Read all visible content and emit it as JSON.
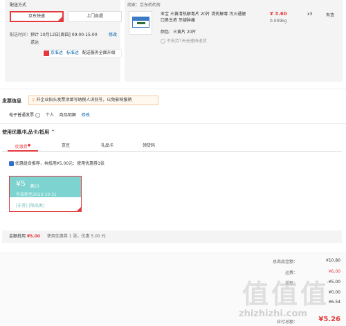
{
  "delivery": {
    "title": "配送方式",
    "options": [
      "京东快递",
      "上门自提"
    ],
    "time_label": "配送时间：",
    "time_value": "预计 10月12日[周四] 09:00-15:00 送达",
    "modify": "修改",
    "badges": [
      "京准达",
      "标准达",
      "配送服务全面升级"
    ]
  },
  "store": {
    "merchant": "商家：京东药药房",
    "product_name": "亚宝 三黄清热解毒片 20片 清热解毒 泻火通便 口鼻生疮 牙龈肿痛",
    "price": "¥ 3.60",
    "weight": "0.009kg",
    "qty": "x3",
    "stock": "有货",
    "color_label": "颜色：",
    "color_value": "三黄片 20片",
    "no_return": "不支持7天无理由退货"
  },
  "invoice": {
    "title": "发票信息",
    "notice": "开企业抬头发票须填写纳税人识别号，以免影响报销",
    "type": "电子普通发票",
    "person": "个人",
    "detail": "商品明细",
    "modify": "修改"
  },
  "coupon_section": {
    "title": "使用优惠/礼品卡/抵用",
    "tabs": [
      "优惠券",
      "京豆",
      "礼品卡",
      "领货码"
    ],
    "recommend": "优惠组合推荐，共抵用¥5.00元：使用优惠券1张",
    "coupon": {
      "amount": "¥5",
      "cond": "满10",
      "expire": "有效期至2023-10-31",
      "tags": "[东券] [限品类]"
    },
    "summary_label": "金额抵用",
    "summary_amount": "¥5.00",
    "summary_detail": "使用优惠券 1 张，优惠 5.00 元"
  },
  "totals": {
    "goods_label": "总商品金额：",
    "goods_value": "¥10.80",
    "freight_label": "运费：",
    "freight_value": "¥6.00",
    "coupon_label": "返现：",
    "coupon_value": "-¥5.00",
    "extra_value": "¥0.00",
    "weight_value": "¥6.54",
    "pay_label": "应付总额：",
    "pay_value": "¥5.26"
  },
  "watermark": {
    "big": "值值值",
    "small": "zhizhizhi.com"
  },
  "colors": {
    "accent": "#e4393c",
    "link": "#005ea7",
    "coupon": "#7dd3d0"
  }
}
